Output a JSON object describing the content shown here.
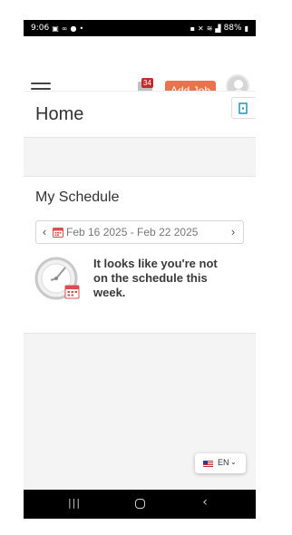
{
  "status_bar": {
    "time": "9:06",
    "left_icons": [
      "image-icon",
      "voicemail-icon",
      "chat-icon",
      "dot-icon"
    ],
    "right_icons": [
      "lock-icon",
      "mute-icon",
      "wifi-icon",
      "signal-icon"
    ],
    "battery": "88%"
  },
  "header": {
    "notification_count": "34",
    "add_job_label": "Add Job",
    "menu_icon": "hamburger-icon",
    "avatar_icon": "user-avatar-icon"
  },
  "page": {
    "title": "Home",
    "export_icon": "sign-out-icon"
  },
  "schedule": {
    "title": "My Schedule",
    "prev": "‹",
    "next": "›",
    "date_range": "Feb 16 2025 - Feb 22 2025",
    "calendar_icon": "calendar-icon",
    "empty_icon": "clock-calendar-icon",
    "empty_message": "It looks like you're not on the schedule this week."
  },
  "language": {
    "code": "EN",
    "flag": "us-flag-icon",
    "caret": "⌄"
  },
  "system_nav": {
    "recent": "|||",
    "back": "‹"
  },
  "colors": {
    "accent": "#e8734f",
    "badge": "#c52b2b",
    "calendar": "#d94f4f",
    "export_icon": "#1a8fb0"
  }
}
